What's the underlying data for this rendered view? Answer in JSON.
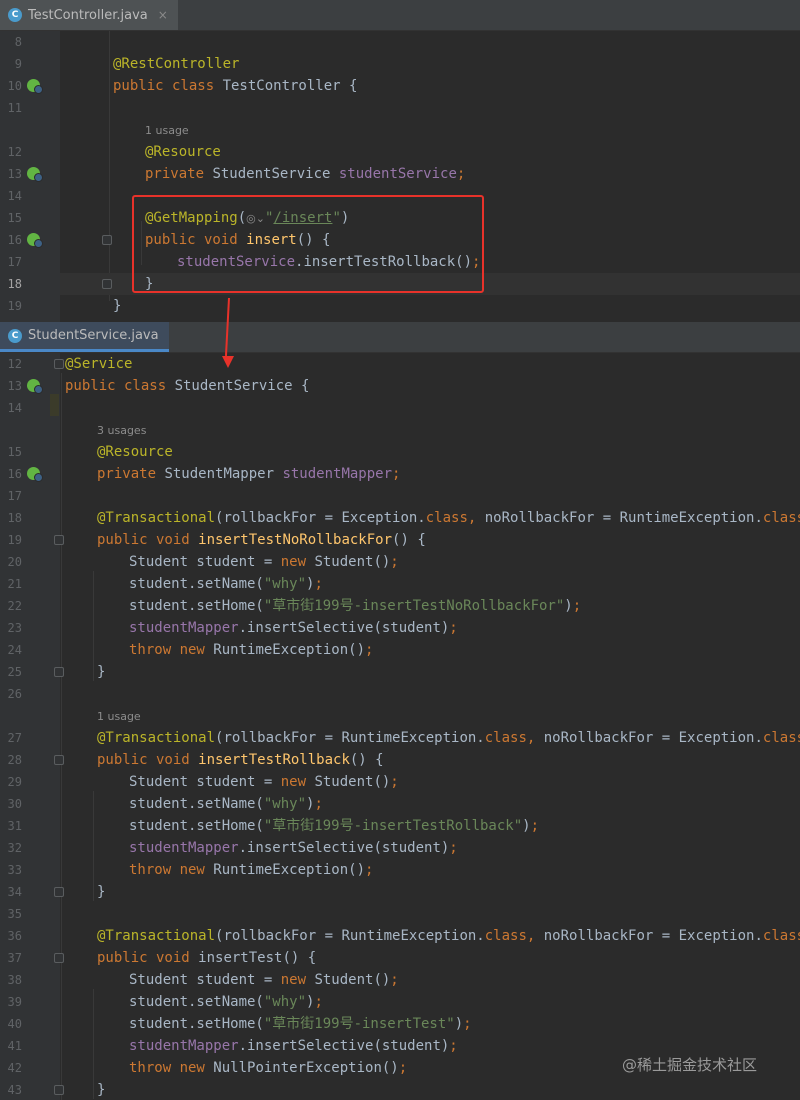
{
  "tabs": [
    {
      "label": "TestController.java",
      "icon": "class-c-icon",
      "close": "×"
    },
    {
      "label": "StudentService.java",
      "icon": "class-c-icon"
    }
  ],
  "pane1_lines": [
    {
      "n": "8",
      "segs": []
    },
    {
      "n": "9",
      "segs": [
        {
          "t": "@RestController",
          "c": "ann"
        }
      ]
    },
    {
      "n": "10",
      "gicon": true,
      "segs": [
        {
          "t": "public class ",
          "c": "kw"
        },
        {
          "t": "TestController {",
          "c": ""
        }
      ]
    },
    {
      "n": "11",
      "segs": []
    },
    {
      "n": "",
      "hint": "1 usage",
      "indent": 1
    },
    {
      "n": "12",
      "indent": 1,
      "segs": [
        {
          "t": "@Resource",
          "c": "ann"
        }
      ]
    },
    {
      "n": "13",
      "gicon": true,
      "indent": 1,
      "segs": [
        {
          "t": "private ",
          "c": "kw"
        },
        {
          "t": "StudentService ",
          "c": ""
        },
        {
          "t": "studentService",
          "c": "fld"
        },
        {
          "t": ";",
          "c": "kw"
        }
      ]
    },
    {
      "n": "14",
      "segs": []
    },
    {
      "n": "15",
      "indent": 1,
      "segs": [
        {
          "t": "@GetMapping",
          "c": "ann"
        },
        {
          "t": "(",
          "c": ""
        },
        {
          "t": "◎⌄",
          "c": "hint"
        },
        {
          "t": "\"",
          "c": "str"
        },
        {
          "t": "/insert",
          "c": "url"
        },
        {
          "t": "\"",
          "c": "str"
        },
        {
          "t": ")",
          "c": ""
        }
      ]
    },
    {
      "n": "16",
      "gicon": true,
      "fold": true,
      "indent": 1,
      "segs": [
        {
          "t": "public void ",
          "c": "kw"
        },
        {
          "t": "insert",
          "c": "fn"
        },
        {
          "t": "() {",
          "c": ""
        }
      ]
    },
    {
      "n": "17",
      "indent": 2,
      "segs": [
        {
          "t": "studentService",
          "c": "fld"
        },
        {
          "t": ".insertTestRollback()",
          "c": ""
        },
        {
          "t": ";",
          "c": "kw"
        }
      ]
    },
    {
      "n": "18",
      "fold": true,
      "cur": true,
      "indent": 1,
      "segs": [
        {
          "t": "}",
          "c": ""
        }
      ]
    },
    {
      "n": "19",
      "segs": [
        {
          "t": "}",
          "c": ""
        }
      ]
    },
    {
      "n": "20",
      "segs": []
    }
  ],
  "pane2_lines": [
    {
      "n": "12",
      "fold": true,
      "segs": [
        {
          "t": "@Service",
          "c": "ann"
        }
      ]
    },
    {
      "n": "13",
      "gicon": true,
      "segs": [
        {
          "t": "public class ",
          "c": "kw"
        },
        {
          "t": "StudentService {",
          "c": ""
        }
      ]
    },
    {
      "n": "14",
      "segs": []
    },
    {
      "n": "",
      "hint": "3 usages",
      "indent": 1
    },
    {
      "n": "15",
      "indent": 1,
      "segs": [
        {
          "t": "@Resource",
          "c": "ann"
        }
      ]
    },
    {
      "n": "16",
      "gicon": true,
      "indent": 1,
      "segs": [
        {
          "t": "private ",
          "c": "kw"
        },
        {
          "t": "StudentMapper ",
          "c": ""
        },
        {
          "t": "studentMapper",
          "c": "fld"
        },
        {
          "t": ";",
          "c": "kw"
        }
      ]
    },
    {
      "n": "17",
      "segs": []
    },
    {
      "n": "18",
      "indent": 1,
      "segs": [
        {
          "t": "@Transactional",
          "c": "ann"
        },
        {
          "t": "(rollbackFor = Exception.",
          "c": ""
        },
        {
          "t": "class",
          "c": "kw"
        },
        {
          "t": ", ",
          "c": "kw"
        },
        {
          "t": "noRollbackFor = RuntimeException.",
          "c": ""
        },
        {
          "t": "class",
          "c": "kw"
        },
        {
          "t": ")",
          "c": ""
        }
      ]
    },
    {
      "n": "19",
      "fold": true,
      "indent": 1,
      "segs": [
        {
          "t": "public void ",
          "c": "kw"
        },
        {
          "t": "insertTestNoRollbackFor",
          "c": "fn"
        },
        {
          "t": "() {",
          "c": ""
        }
      ]
    },
    {
      "n": "20",
      "indent": 2,
      "segs": [
        {
          "t": "Student student = ",
          "c": ""
        },
        {
          "t": "new ",
          "c": "kw"
        },
        {
          "t": "Student()",
          "c": ""
        },
        {
          "t": ";",
          "c": "kw"
        }
      ]
    },
    {
      "n": "21",
      "indent": 2,
      "segs": [
        {
          "t": "student.setName(",
          "c": ""
        },
        {
          "t": "\"why\"",
          "c": "str"
        },
        {
          "t": ")",
          "c": ""
        },
        {
          "t": ";",
          "c": "kw"
        }
      ]
    },
    {
      "n": "22",
      "indent": 2,
      "segs": [
        {
          "t": "student.setHome(",
          "c": ""
        },
        {
          "t": "\"草市街199号-insertTestNoRollbackFor\"",
          "c": "str"
        },
        {
          "t": ")",
          "c": ""
        },
        {
          "t": ";",
          "c": "kw"
        }
      ]
    },
    {
      "n": "23",
      "indent": 2,
      "segs": [
        {
          "t": "studentMapper",
          "c": "fld"
        },
        {
          "t": ".insertSelective(student)",
          "c": ""
        },
        {
          "t": ";",
          "c": "kw"
        }
      ]
    },
    {
      "n": "24",
      "indent": 2,
      "segs": [
        {
          "t": "throw new ",
          "c": "kw"
        },
        {
          "t": "RuntimeException()",
          "c": ""
        },
        {
          "t": ";",
          "c": "kw"
        }
      ]
    },
    {
      "n": "25",
      "fold": true,
      "indent": 1,
      "segs": [
        {
          "t": "}",
          "c": ""
        }
      ]
    },
    {
      "n": "26",
      "segs": []
    },
    {
      "n": "",
      "hint": "1 usage",
      "indent": 1
    },
    {
      "n": "27",
      "indent": 1,
      "segs": [
        {
          "t": "@Transactional",
          "c": "ann"
        },
        {
          "t": "(rollbackFor = RuntimeException.",
          "c": ""
        },
        {
          "t": "class",
          "c": "kw"
        },
        {
          "t": ", ",
          "c": "kw"
        },
        {
          "t": "noRollbackFor = Exception.",
          "c": ""
        },
        {
          "t": "class",
          "c": "kw"
        },
        {
          "t": ")",
          "c": ""
        }
      ]
    },
    {
      "n": "28",
      "fold": true,
      "indent": 1,
      "segs": [
        {
          "t": "public void ",
          "c": "kw"
        },
        {
          "t": "insertTestRollback",
          "c": "fn"
        },
        {
          "t": "() {",
          "c": ""
        }
      ]
    },
    {
      "n": "29",
      "indent": 2,
      "segs": [
        {
          "t": "Student student = ",
          "c": ""
        },
        {
          "t": "new ",
          "c": "kw"
        },
        {
          "t": "Student()",
          "c": ""
        },
        {
          "t": ";",
          "c": "kw"
        }
      ]
    },
    {
      "n": "30",
      "indent": 2,
      "segs": [
        {
          "t": "student.setName(",
          "c": ""
        },
        {
          "t": "\"why\"",
          "c": "str"
        },
        {
          "t": ")",
          "c": ""
        },
        {
          "t": ";",
          "c": "kw"
        }
      ]
    },
    {
      "n": "31",
      "indent": 2,
      "segs": [
        {
          "t": "student.setHome(",
          "c": ""
        },
        {
          "t": "\"草市街199号-insertTestRollback\"",
          "c": "str"
        },
        {
          "t": ")",
          "c": ""
        },
        {
          "t": ";",
          "c": "kw"
        }
      ]
    },
    {
      "n": "32",
      "indent": 2,
      "segs": [
        {
          "t": "studentMapper",
          "c": "fld"
        },
        {
          "t": ".insertSelective(student)",
          "c": ""
        },
        {
          "t": ";",
          "c": "kw"
        }
      ]
    },
    {
      "n": "33",
      "indent": 2,
      "segs": [
        {
          "t": "throw new ",
          "c": "kw"
        },
        {
          "t": "RuntimeException()",
          "c": ""
        },
        {
          "t": ";",
          "c": "kw"
        }
      ]
    },
    {
      "n": "34",
      "fold": true,
      "indent": 1,
      "segs": [
        {
          "t": "}",
          "c": ""
        }
      ]
    },
    {
      "n": "35",
      "segs": []
    },
    {
      "n": "36",
      "indent": 1,
      "segs": [
        {
          "t": "@Transactional",
          "c": "ann"
        },
        {
          "t": "(rollbackFor = RuntimeException.",
          "c": ""
        },
        {
          "t": "class",
          "c": "kw"
        },
        {
          "t": ", ",
          "c": "kw"
        },
        {
          "t": "noRollbackFor = Exception.",
          "c": ""
        },
        {
          "t": "class",
          "c": "kw"
        },
        {
          "t": ")",
          "c": ""
        }
      ]
    },
    {
      "n": "37",
      "fold": true,
      "indent": 1,
      "segs": [
        {
          "t": "public void ",
          "c": "kw"
        },
        {
          "t": "insertTest",
          "c": ""
        },
        {
          "t": "() {",
          "c": ""
        }
      ]
    },
    {
      "n": "38",
      "indent": 2,
      "segs": [
        {
          "t": "Student student = ",
          "c": ""
        },
        {
          "t": "new ",
          "c": "kw"
        },
        {
          "t": "Student()",
          "c": ""
        },
        {
          "t": ";",
          "c": "kw"
        }
      ]
    },
    {
      "n": "39",
      "indent": 2,
      "segs": [
        {
          "t": "student.setName(",
          "c": ""
        },
        {
          "t": "\"why\"",
          "c": "str"
        },
        {
          "t": ")",
          "c": ""
        },
        {
          "t": ";",
          "c": "kw"
        }
      ]
    },
    {
      "n": "40",
      "indent": 2,
      "segs": [
        {
          "t": "student.setHome(",
          "c": ""
        },
        {
          "t": "\"草市街199号-insertTest\"",
          "c": "str"
        },
        {
          "t": ")",
          "c": ""
        },
        {
          "t": ";",
          "c": "kw"
        }
      ]
    },
    {
      "n": "41",
      "indent": 2,
      "segs": [
        {
          "t": "studentMapper",
          "c": "fld"
        },
        {
          "t": ".insertSelective(student)",
          "c": ""
        },
        {
          "t": ";",
          "c": "kw"
        }
      ]
    },
    {
      "n": "42",
      "indent": 2,
      "segs": [
        {
          "t": "throw new ",
          "c": "kw"
        },
        {
          "t": "NullPointerException()",
          "c": ""
        },
        {
          "t": ";",
          "c": "kw"
        }
      ]
    },
    {
      "n": "43",
      "fold": true,
      "indent": 1,
      "segs": [
        {
          "t": "}",
          "c": ""
        }
      ]
    }
  ],
  "watermark": "@稀土掘金技术社区",
  "colors": {
    "background": "#2b2b2b",
    "keyword": "#cc7832",
    "annotation": "#bbb529",
    "string": "#6a8759",
    "field": "#9876aa",
    "method": "#ffc66d",
    "highlight": "#e8322a"
  }
}
